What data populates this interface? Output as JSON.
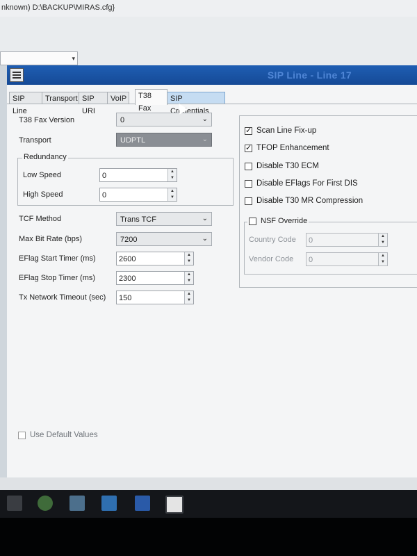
{
  "window": {
    "title": "nknown) D:\\BACKUP\\MIRAS.cfg}"
  },
  "header": {
    "title": "SIP Line - Line 17"
  },
  "tabs": [
    {
      "label": "SIP Line"
    },
    {
      "label": "Transport"
    },
    {
      "label": "SIP URI"
    },
    {
      "label": "VoIP"
    },
    {
      "label": "T38 Fax"
    },
    {
      "label": "SIP Credentials"
    }
  ],
  "left": {
    "t38_version": {
      "label": "T38 Fax Version",
      "value": "0"
    },
    "transport": {
      "label": "Transport",
      "value": "UDPTL"
    },
    "redundancy": {
      "title": "Redundancy",
      "low": {
        "label": "Low Speed",
        "value": "0"
      },
      "high": {
        "label": "High Speed",
        "value": "0"
      }
    },
    "tcf": {
      "label": "TCF Method",
      "value": "Trans TCF"
    },
    "max_bit": {
      "label": "Max Bit Rate (bps)",
      "value": "7200"
    },
    "eflag_start": {
      "label": "EFlag Start Timer (ms)",
      "value": "2600"
    },
    "eflag_stop": {
      "label": "EFlag Stop Timer (ms)",
      "value": "2300"
    },
    "tx_timeout": {
      "label": "Tx Network Timeout (sec)",
      "value": "150"
    }
  },
  "right": {
    "checks": [
      {
        "label": "Scan Line Fix-up",
        "checked": true
      },
      {
        "label": "TFOP Enhancement",
        "checked": true
      },
      {
        "label": "Disable T30 ECM",
        "checked": false
      },
      {
        "label": "Disable EFlags For First DIS",
        "checked": false
      },
      {
        "label": "Disable T30 MR Compression",
        "checked": false
      }
    ],
    "nsf": {
      "label": "NSF Override",
      "checked": false,
      "country": {
        "label": "Country Code",
        "value": "0"
      },
      "vendor": {
        "label": "Vendor Code",
        "value": "0"
      }
    }
  },
  "footer": {
    "use_default_label": "Use Default Values",
    "checked": false
  },
  "taskbar": {
    "icons": [
      "explorer-icon",
      "chrome-icon",
      "mail-icon",
      "vscode-icon",
      "word-icon",
      "app-icon"
    ]
  }
}
